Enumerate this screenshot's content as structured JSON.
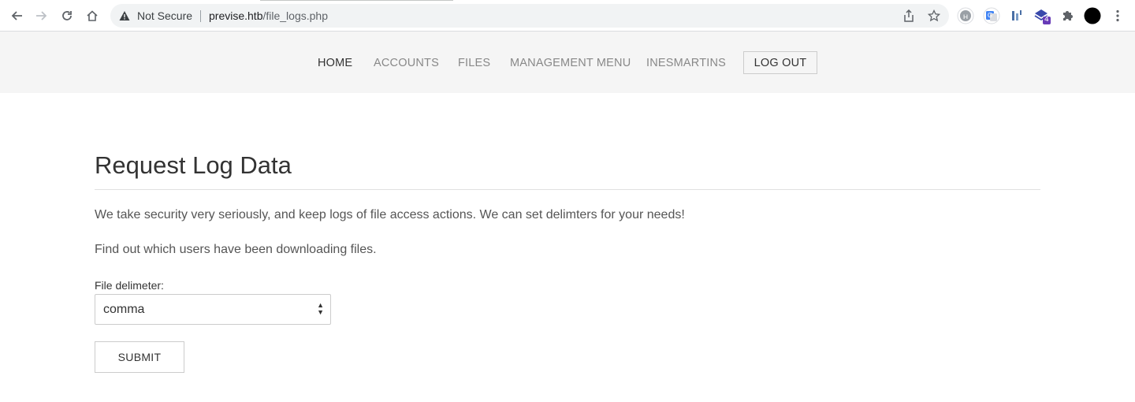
{
  "browser": {
    "security_label": "Not Secure",
    "url_host": "previse.htb",
    "url_path": "/file_logs.php",
    "extension_badge": "4"
  },
  "nav": {
    "items": [
      {
        "label": "HOME",
        "active": true
      },
      {
        "label": "ACCOUNTS",
        "active": false
      },
      {
        "label": "FILES",
        "active": false
      },
      {
        "label": "MANAGEMENT MENU",
        "active": false
      },
      {
        "label": "INESMARTINS",
        "active": false
      }
    ],
    "logout_label": "LOG OUT"
  },
  "main": {
    "title": "Request Log Data",
    "paragraph_1": "We take security very seriously, and keep logs of file access actions. We can set delimters for your needs!",
    "paragraph_2": "Find out which users have been downloading files.",
    "delimiter_label": "File delimeter:",
    "delimiter_selected": "comma",
    "submit_label": "SUBMIT"
  }
}
